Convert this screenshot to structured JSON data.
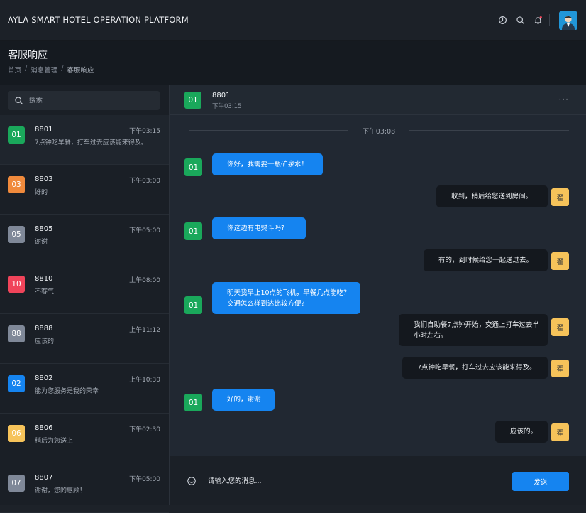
{
  "app": {
    "title": "AYLA SMART HOTEL OPERATION PLATFORM",
    "icons": [
      "dashboard-icon",
      "search-icon",
      "bell-icon",
      "user-avatar"
    ]
  },
  "page": {
    "title": "客服响应",
    "breadcrumb": [
      "首页",
      "消息管理",
      "客服响应"
    ]
  },
  "search": {
    "placeholder": "搜索"
  },
  "conversations": [
    {
      "room": "01",
      "color": "#1aa85b",
      "time": "下午03:15",
      "message": "7点钟吃早餐，打车过去应该能来得及。",
      "active": true
    },
    {
      "room": "03",
      "color": "#f08a3c",
      "time": "下午03:00",
      "message": "好的"
    },
    {
      "room": "05",
      "color": "#7f8898",
      "time": "下午05:00",
      "message": "谢谢"
    },
    {
      "room": "10",
      "color": "#f0445a",
      "time": "上午08:00",
      "message": "不客气"
    },
    {
      "room": "88",
      "color": "#7f8898",
      "time": "上午11:12",
      "message": "应该的"
    },
    {
      "room": "02",
      "color": "#1584f0",
      "time": "上午10:30",
      "message": "能为您服务是我的荣幸"
    },
    {
      "room": "06",
      "color": "#f6c35a",
      "time": "下午02:30",
      "message": "稍后为您送上"
    },
    {
      "room": "07",
      "color": "#7f8898",
      "time": "下午05:00",
      "message": "谢谢，您的惠顾！"
    }
  ],
  "conversation_names": [
    "8801",
    "8803",
    "8805",
    "8810",
    "8888",
    "8802",
    "8806",
    "8807"
  ],
  "chat": {
    "room": "01",
    "name": "8801",
    "subtitle": "下午03:15",
    "more": "···",
    "day_separator": "下午03:08",
    "staff_avatar": "翟",
    "messages": [
      {
        "from": "guest",
        "text": "你好，我需要一瓶矿泉水！"
      },
      {
        "from": "staff",
        "text": "收到，稍后给您送到房间。"
      },
      {
        "from": "guest",
        "text": "你这边有电熨斗吗?"
      },
      {
        "from": "staff",
        "text": "有的，到时候给您一起送过去。"
      },
      {
        "from": "guest",
        "text": "明天我早上10点的飞机，早餐几点能吃？交通怎么样到达比较方便?"
      },
      {
        "from": "staff",
        "text": "我们自助餐7点钟开始，交通上打车过去半小时左右。"
      },
      {
        "from": "staff",
        "text": "7点钟吃早餐，打车过去应该能来得及。"
      },
      {
        "from": "guest",
        "text": "好的，谢谢"
      },
      {
        "from": "staff",
        "text": "应该的。"
      }
    ]
  },
  "composer": {
    "placeholder": "请输入您的消息...",
    "send_label": "发送"
  },
  "colors": {
    "accent": "#1584f0",
    "guest_avatar": "#1aa85b",
    "staff_avatar": "#f6c35a"
  }
}
